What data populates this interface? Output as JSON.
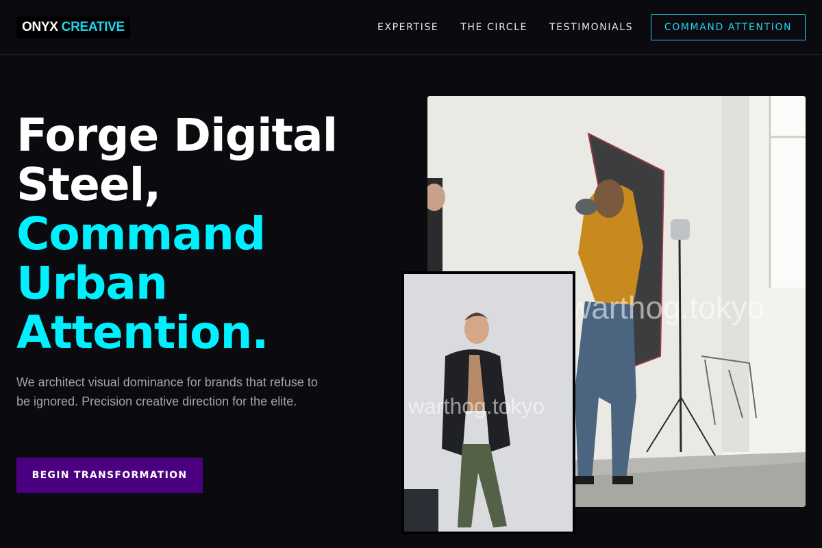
{
  "brand": {
    "logo_word1": "ONYX",
    "logo_word2": "CREATIVE",
    "accent_color": "#22d3ee"
  },
  "nav": {
    "items": [
      {
        "label": "EXPERTISE"
      },
      {
        "label": "THE CIRCLE"
      },
      {
        "label": "TESTIMONIALS"
      }
    ],
    "cta_label": "COMMAND ATTENTION"
  },
  "hero": {
    "headline_white": [
      "Forge Digital",
      "Steel,"
    ],
    "headline_cyan": [
      "Command",
      "Urban",
      "Attention."
    ],
    "subtext": "We architect visual dominance for brands that refuse to be ignored. Precision creative direction for the elite.",
    "cta_label": "BEGIN TRANSFORMATION",
    "cta_color": "#4b0082",
    "headline_accent_color": "#00f0ff"
  },
  "images": {
    "main_watermark": "warthog.tokyo",
    "secondary_watermark": "warthog.tokyo"
  }
}
